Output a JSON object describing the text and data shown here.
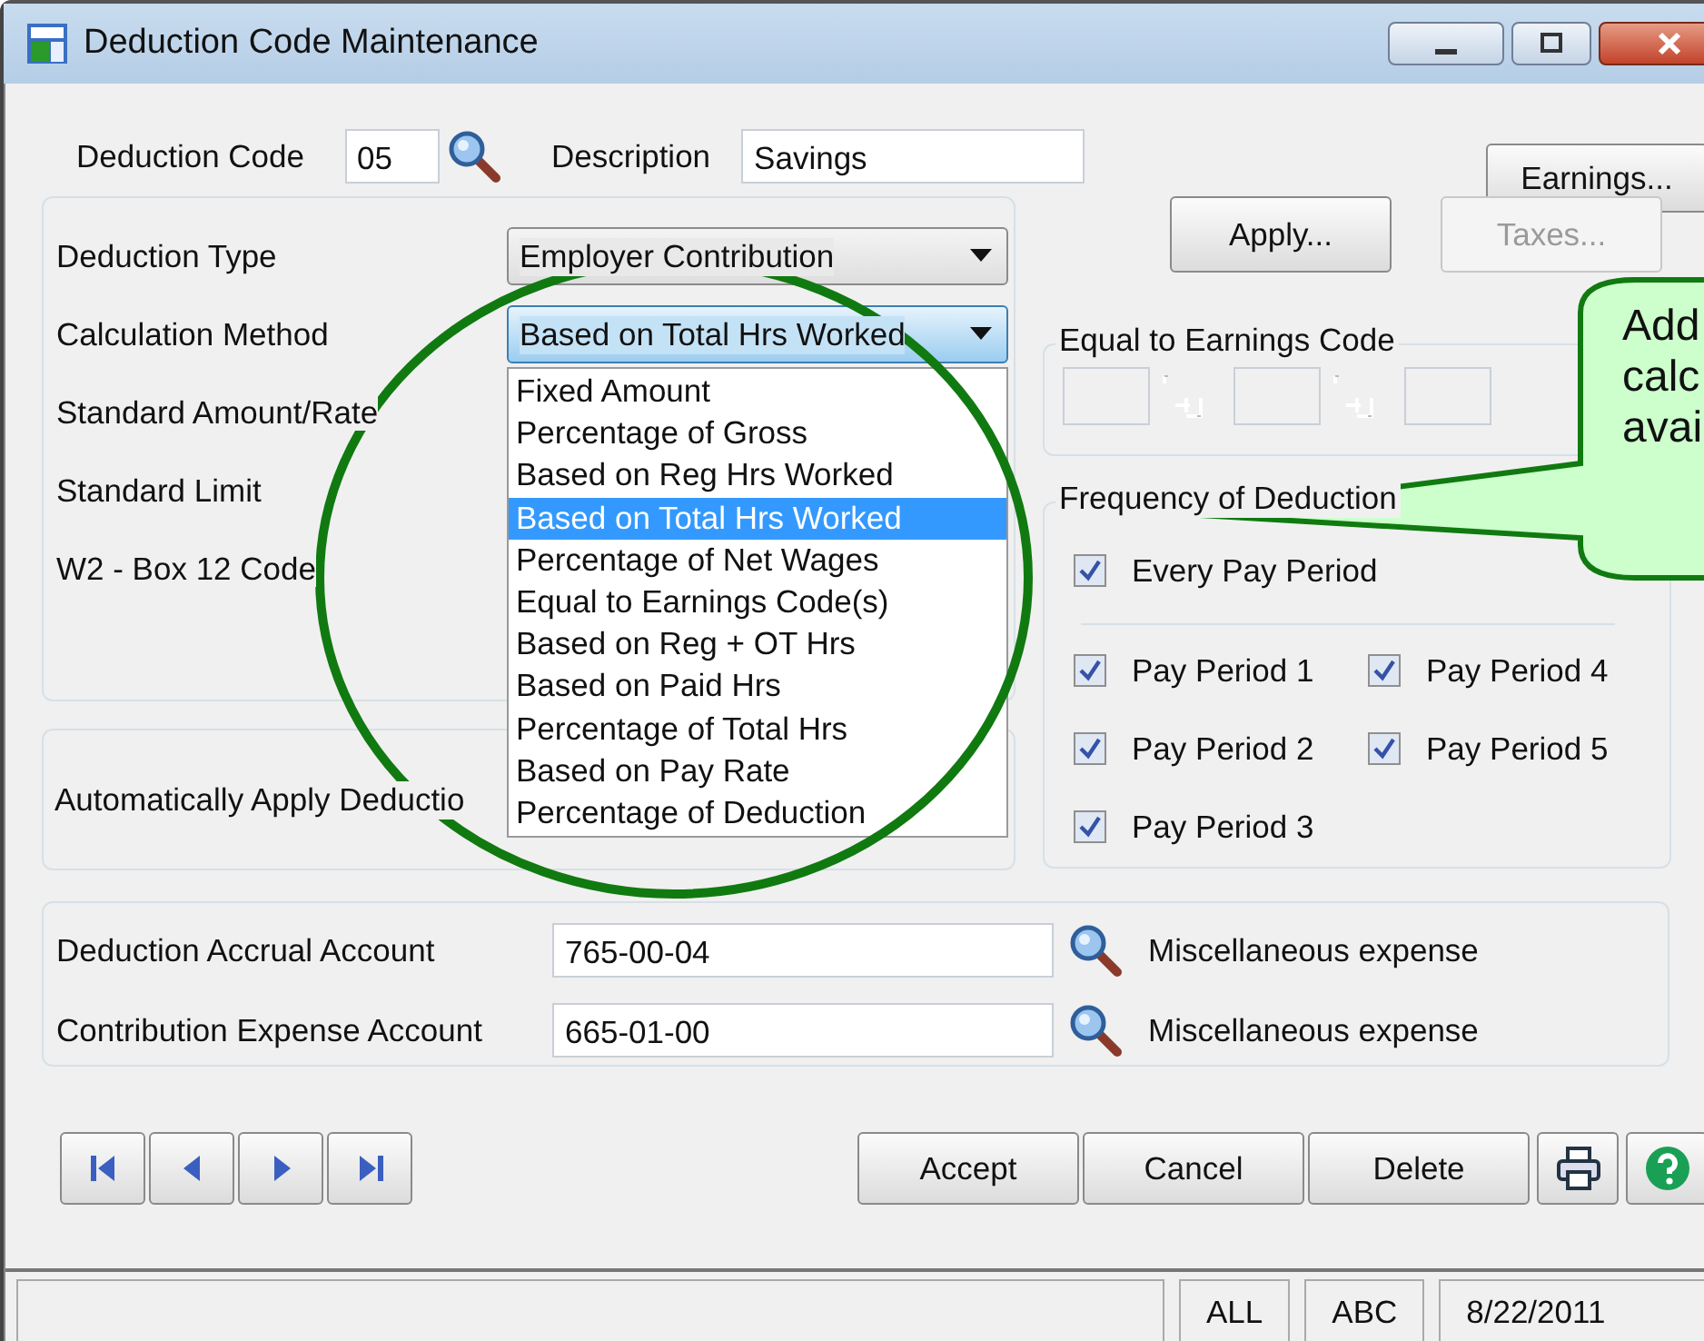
{
  "window": {
    "title": "Deduction Code Maintenance"
  },
  "header": {
    "deduction_code_label": "Deduction Code",
    "deduction_code": "05",
    "description_label": "Description",
    "description": "Savings"
  },
  "top_buttons": [
    {
      "label": "Earnings...",
      "disabled": false
    },
    {
      "label": "Apply...",
      "disabled": false
    },
    {
      "label": "Taxes...",
      "disabled": true
    }
  ],
  "deduction_settings": [
    {
      "label": "Deduction Type",
      "kind": "dropdown",
      "value": "Employer Contribution",
      "focused": false
    },
    {
      "label": "Calculation Method",
      "kind": "dropdown",
      "value": "Based on Total Hrs Worked",
      "focused": true
    },
    {
      "label": "Standard Amount/Rate",
      "kind": "label"
    },
    {
      "label": "Standard Limit",
      "kind": "label"
    },
    {
      "label": "W2 - Box 12 Code",
      "kind": "label"
    }
  ],
  "auto_apply": {
    "label": "Automatically Apply Deductio"
  },
  "calculation_method_list": [
    {
      "label": "Fixed Amount",
      "selected": false
    },
    {
      "label": "Percentage of Gross",
      "selected": false
    },
    {
      "label": "Based on Reg Hrs Worked",
      "selected": false
    },
    {
      "label": "Based on Total Hrs Worked",
      "selected": true
    },
    {
      "label": "Percentage of Net Wages",
      "selected": false
    },
    {
      "label": "Equal to Earnings Code(s)",
      "selected": false
    },
    {
      "label": "Based on Reg + OT Hrs",
      "selected": false
    },
    {
      "label": "Based on Paid Hrs",
      "selected": false
    },
    {
      "label": "Percentage of Total Hrs",
      "selected": false
    },
    {
      "label": "Based on Pay Rate",
      "selected": false
    },
    {
      "label": "Percentage of Deduction",
      "selected": false
    }
  ],
  "equal_to_earnings_code": {
    "title": "Equal to Earnings Code"
  },
  "frequency": {
    "title": "Frequency of Deduction",
    "every_pay_period": {
      "label": "Every Pay Period",
      "checked": true
    },
    "pay_periods": [
      {
        "label": "Pay Period 1",
        "checked": true
      },
      {
        "label": "Pay Period 2",
        "checked": true
      },
      {
        "label": "Pay Period 3",
        "checked": true
      },
      {
        "label": "Pay Period 4",
        "checked": true
      },
      {
        "label": "Pay Period 5",
        "checked": true
      }
    ]
  },
  "accounts": [
    {
      "label": "Deduction Accrual Account",
      "value": "765-00-04",
      "description": "Miscellaneous expense"
    },
    {
      "label": "Contribution Expense Account",
      "value": "665-01-00",
      "description": "Miscellaneous expense"
    }
  ],
  "action_buttons": [
    {
      "label": "Accept"
    },
    {
      "label": "Cancel"
    },
    {
      "label": "Delete"
    }
  ],
  "status_bar": {
    "panels": [
      "ALL",
      "ABC",
      "8/22/2011"
    ]
  },
  "callout": {
    "lines": [
      "Add",
      "calc",
      "avai"
    ]
  }
}
